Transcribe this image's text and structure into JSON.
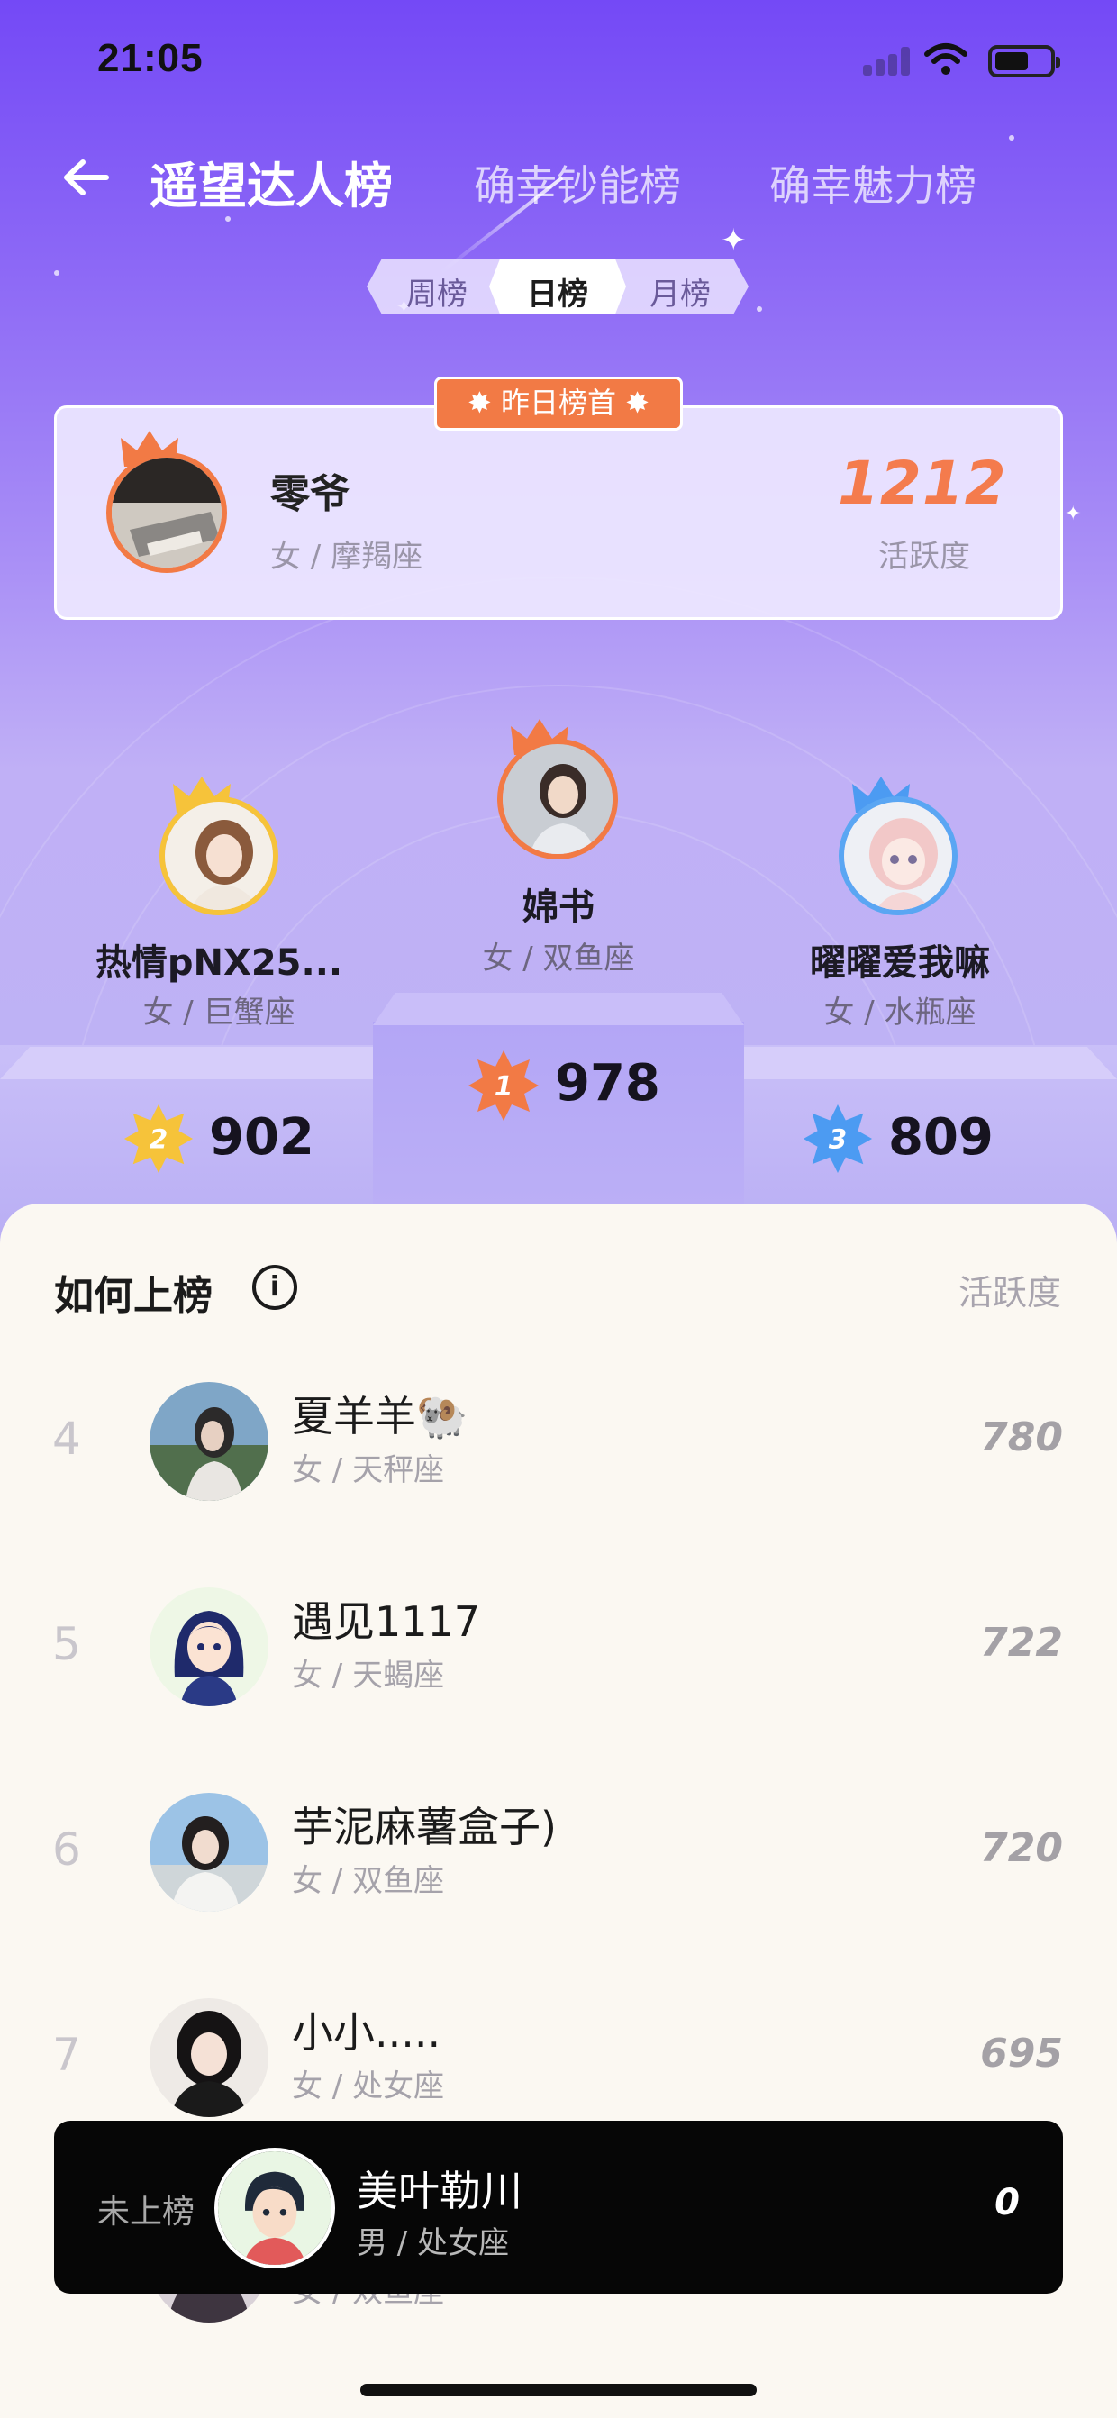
{
  "status_bar": {
    "time": "21:05"
  },
  "nav": {
    "title": "遥望达人榜",
    "tabs": [
      "确幸钞能榜",
      "确幸魅力榜"
    ]
  },
  "period_tabs": {
    "items": [
      "周榜",
      "日榜",
      "月榜"
    ],
    "selected": "日榜"
  },
  "yesterday_top": {
    "badge": "昨日榜首",
    "name": "零爷",
    "sub": "女 / 摩羯座",
    "score": "1212",
    "score_label": "活跃度"
  },
  "podium": [
    {
      "rank": "1",
      "name": "婂书",
      "sub": "女 / 双鱼座",
      "score": "978"
    },
    {
      "rank": "2",
      "name": "热情pNX25...",
      "sub": "女 / 巨蟹座",
      "score": "902"
    },
    {
      "rank": "3",
      "name": "曜曜爱我嘛",
      "sub": "女 / 水瓶座",
      "score": "809"
    }
  ],
  "list_header": {
    "title": "如何上榜",
    "info_icon": "info-icon",
    "right_label": "活跃度"
  },
  "list": [
    {
      "rank": "4",
      "name": "夏羊羊🐏",
      "sub": "女 / 天秤座",
      "score": "780"
    },
    {
      "rank": "5",
      "name": "遇见1117",
      "sub": "女 / 天蝎座",
      "score": "722"
    },
    {
      "rank": "6",
      "name": "芋泥麻薯盒子)",
      "sub": "女 / 双鱼座",
      "score": "720"
    },
    {
      "rank": "7",
      "name": "小小.....",
      "sub": "女 / 处女座",
      "score": "695"
    },
    {
      "rank": "",
      "name": "",
      "sub": "女 / 双鱼座",
      "score": ""
    }
  ],
  "me": {
    "label": "未上榜",
    "name": "美叶勒川",
    "sub": "男 / 处女座",
    "score": "0"
  },
  "colors": {
    "accent_orange": "#f27a45",
    "gold": "#f6c33a",
    "blue": "#4c9bf2",
    "purple_top": "#7449f6"
  }
}
